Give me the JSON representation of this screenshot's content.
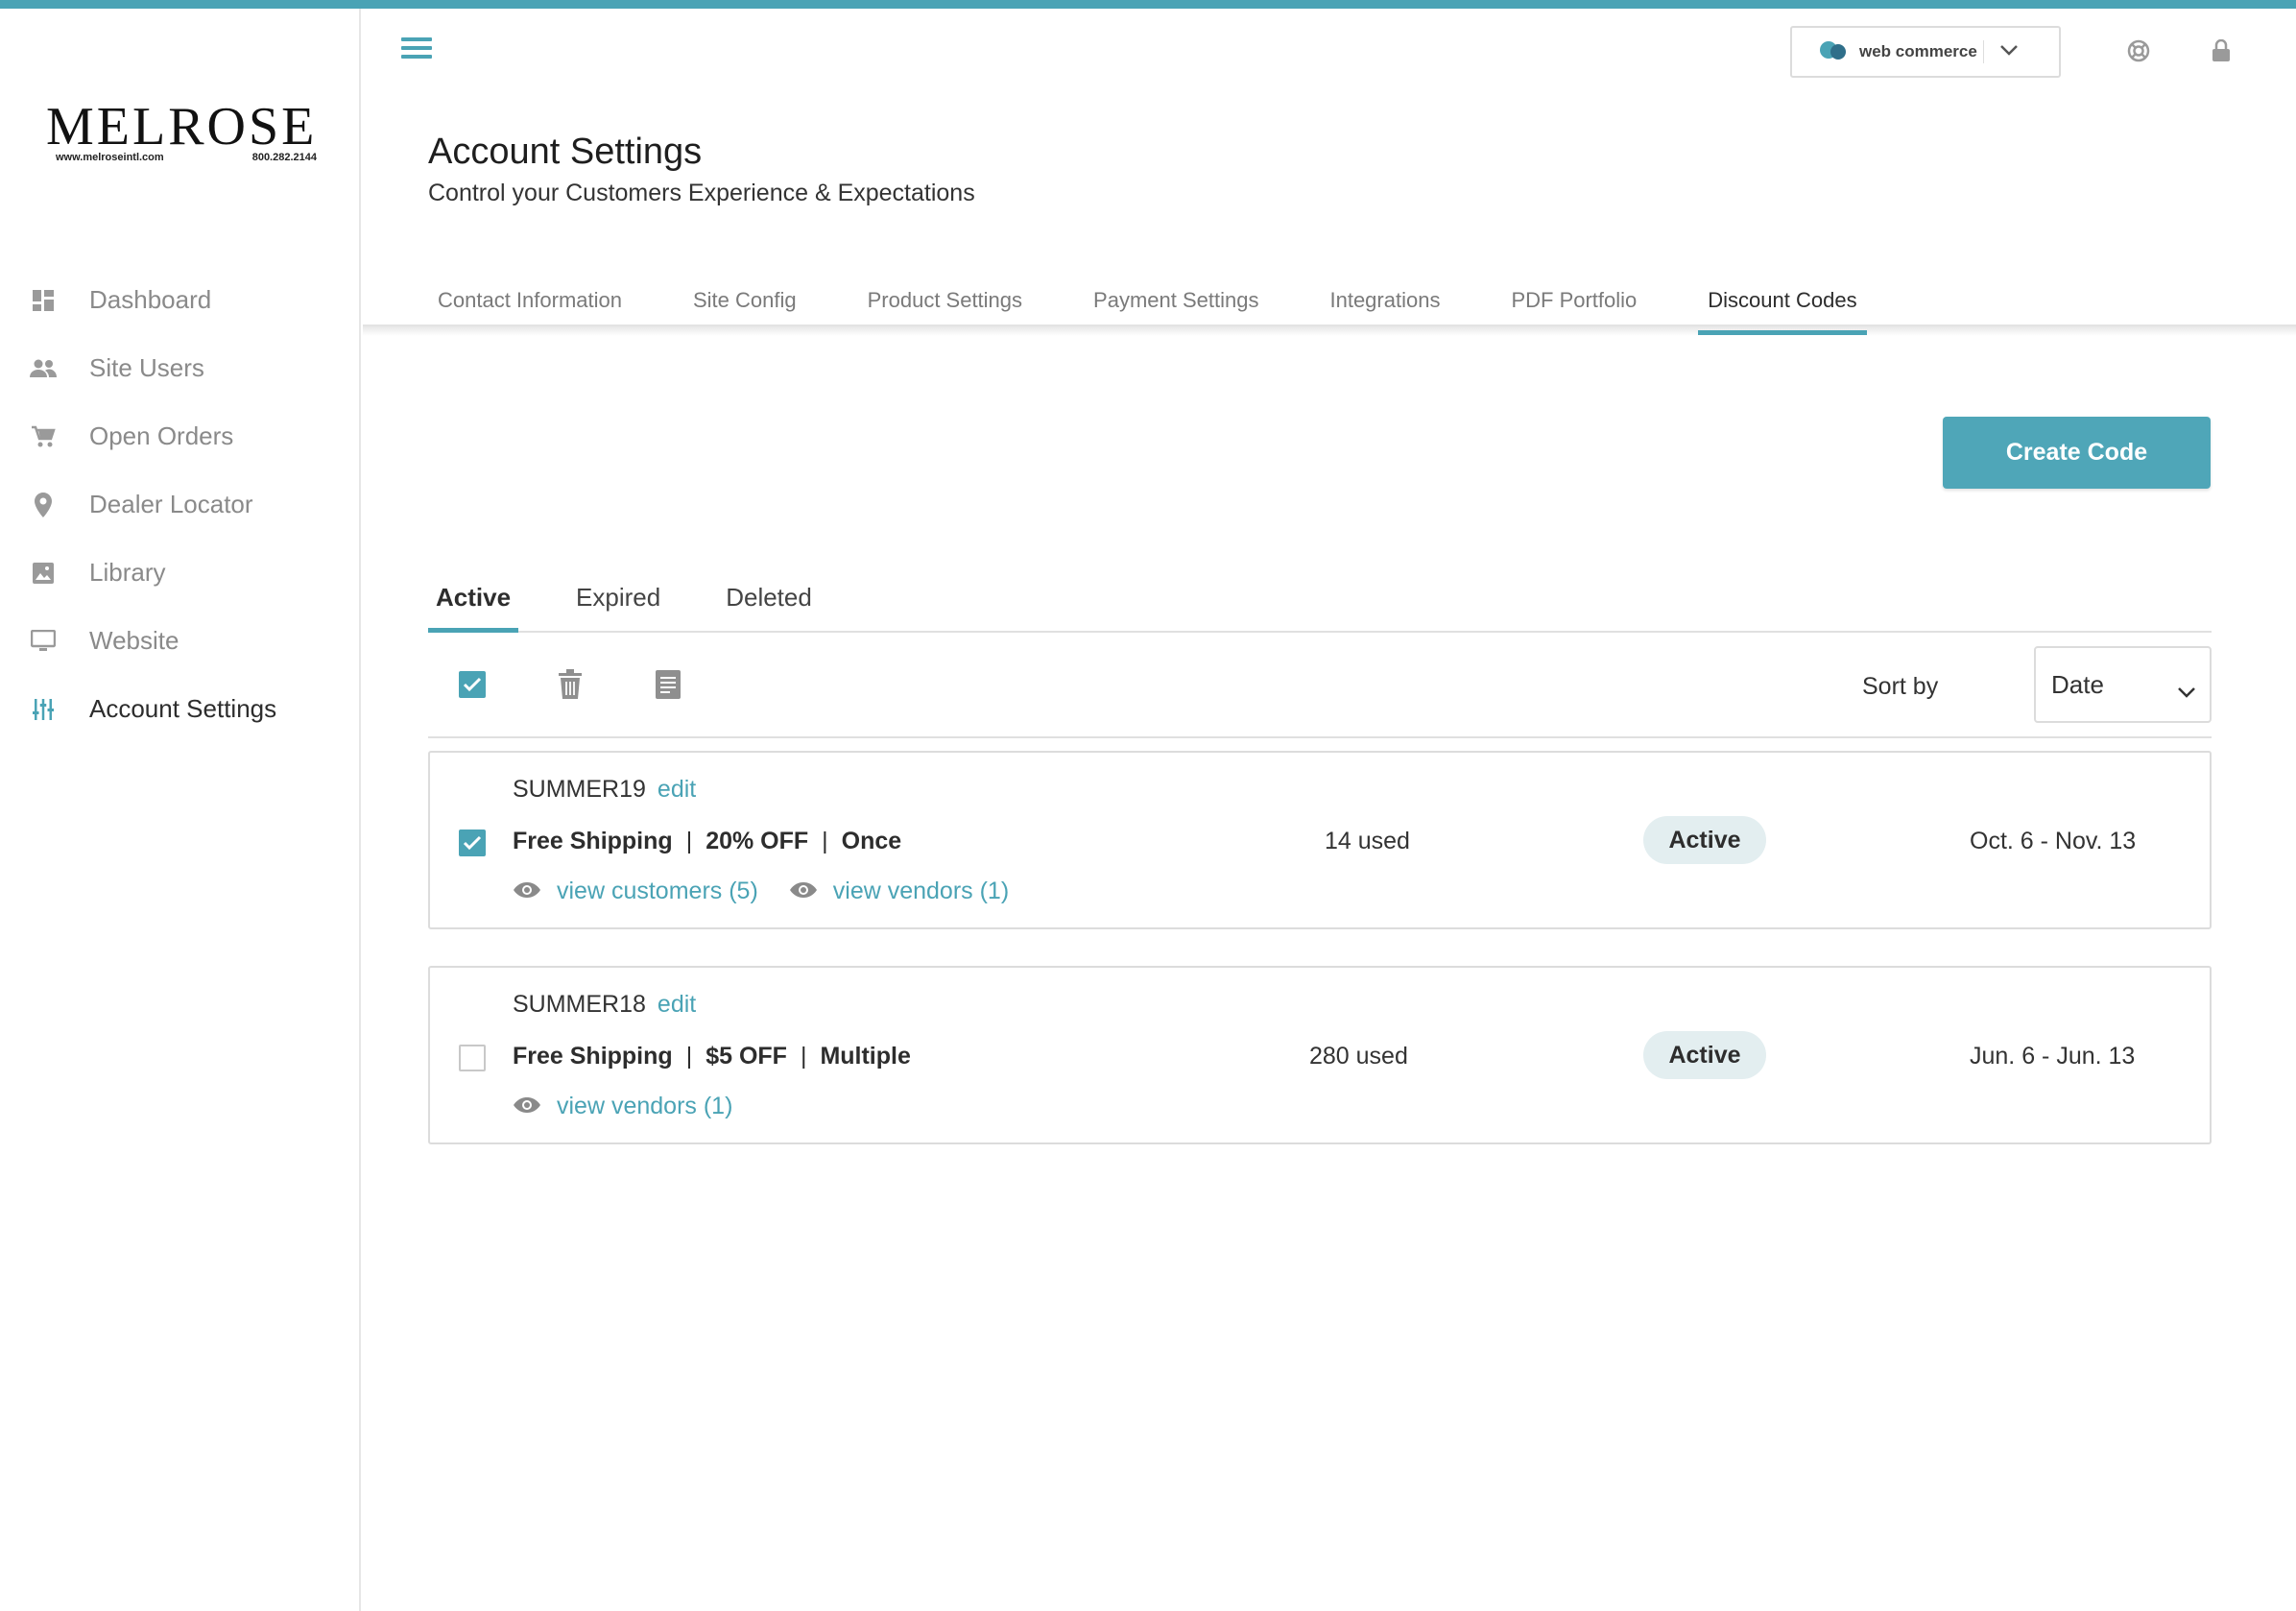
{
  "sidebar": {
    "logo": {
      "word": "MELROSE",
      "url": "www.melroseintl.com",
      "phone": "800.282.2144"
    },
    "items": [
      {
        "label": "Dashboard",
        "icon": "dashboard-icon"
      },
      {
        "label": "Site Users",
        "icon": "users-icon"
      },
      {
        "label": "Open Orders",
        "icon": "cart-icon"
      },
      {
        "label": "Dealer Locator",
        "icon": "location-pin-icon"
      },
      {
        "label": "Library",
        "icon": "image-icon"
      },
      {
        "label": "Website",
        "icon": "monitor-icon"
      },
      {
        "label": "Account Settings",
        "icon": "sliders-icon",
        "active": true
      }
    ]
  },
  "header": {
    "store_selector": {
      "value": "web commerce"
    },
    "title": "Account Settings",
    "subtitle": "Control your Customers Experience & Expectations",
    "tabs": [
      {
        "label": "Contact Information"
      },
      {
        "label": "Site Config"
      },
      {
        "label": "Product Settings"
      },
      {
        "label": "Payment Settings"
      },
      {
        "label": "Integrations"
      },
      {
        "label": "PDF Portfolio"
      },
      {
        "label": "Discount Codes",
        "active": true
      }
    ]
  },
  "discounts": {
    "create_label": "Create Code",
    "status_tabs": [
      {
        "label": "Active",
        "active": true
      },
      {
        "label": "Expired"
      },
      {
        "label": "Deleted"
      }
    ],
    "sort": {
      "label": "Sort by",
      "value": "Date"
    },
    "codes": [
      {
        "code": "SUMMER19",
        "edit": "edit",
        "terms": [
          "Free Shipping",
          "20% OFF",
          "Once"
        ],
        "used": "14 used",
        "status": "Active",
        "dates": "Oct. 6 - Nov. 13",
        "checked": true,
        "links": [
          "view customers (5)",
          "view vendors (1)"
        ]
      },
      {
        "code": "SUMMER18",
        "edit": "edit",
        "terms": [
          "Free Shipping",
          "$5 OFF",
          "Multiple"
        ],
        "used": "280 used",
        "status": "Active",
        "dates": "Jun. 6 - Jun. 13",
        "checked": false,
        "links": [
          "view vendors (1)"
        ]
      }
    ]
  },
  "colors": {
    "accent": "#4aa3b5",
    "badge_bg": "#e3eef0",
    "muted_text": "#8a8a8a"
  }
}
